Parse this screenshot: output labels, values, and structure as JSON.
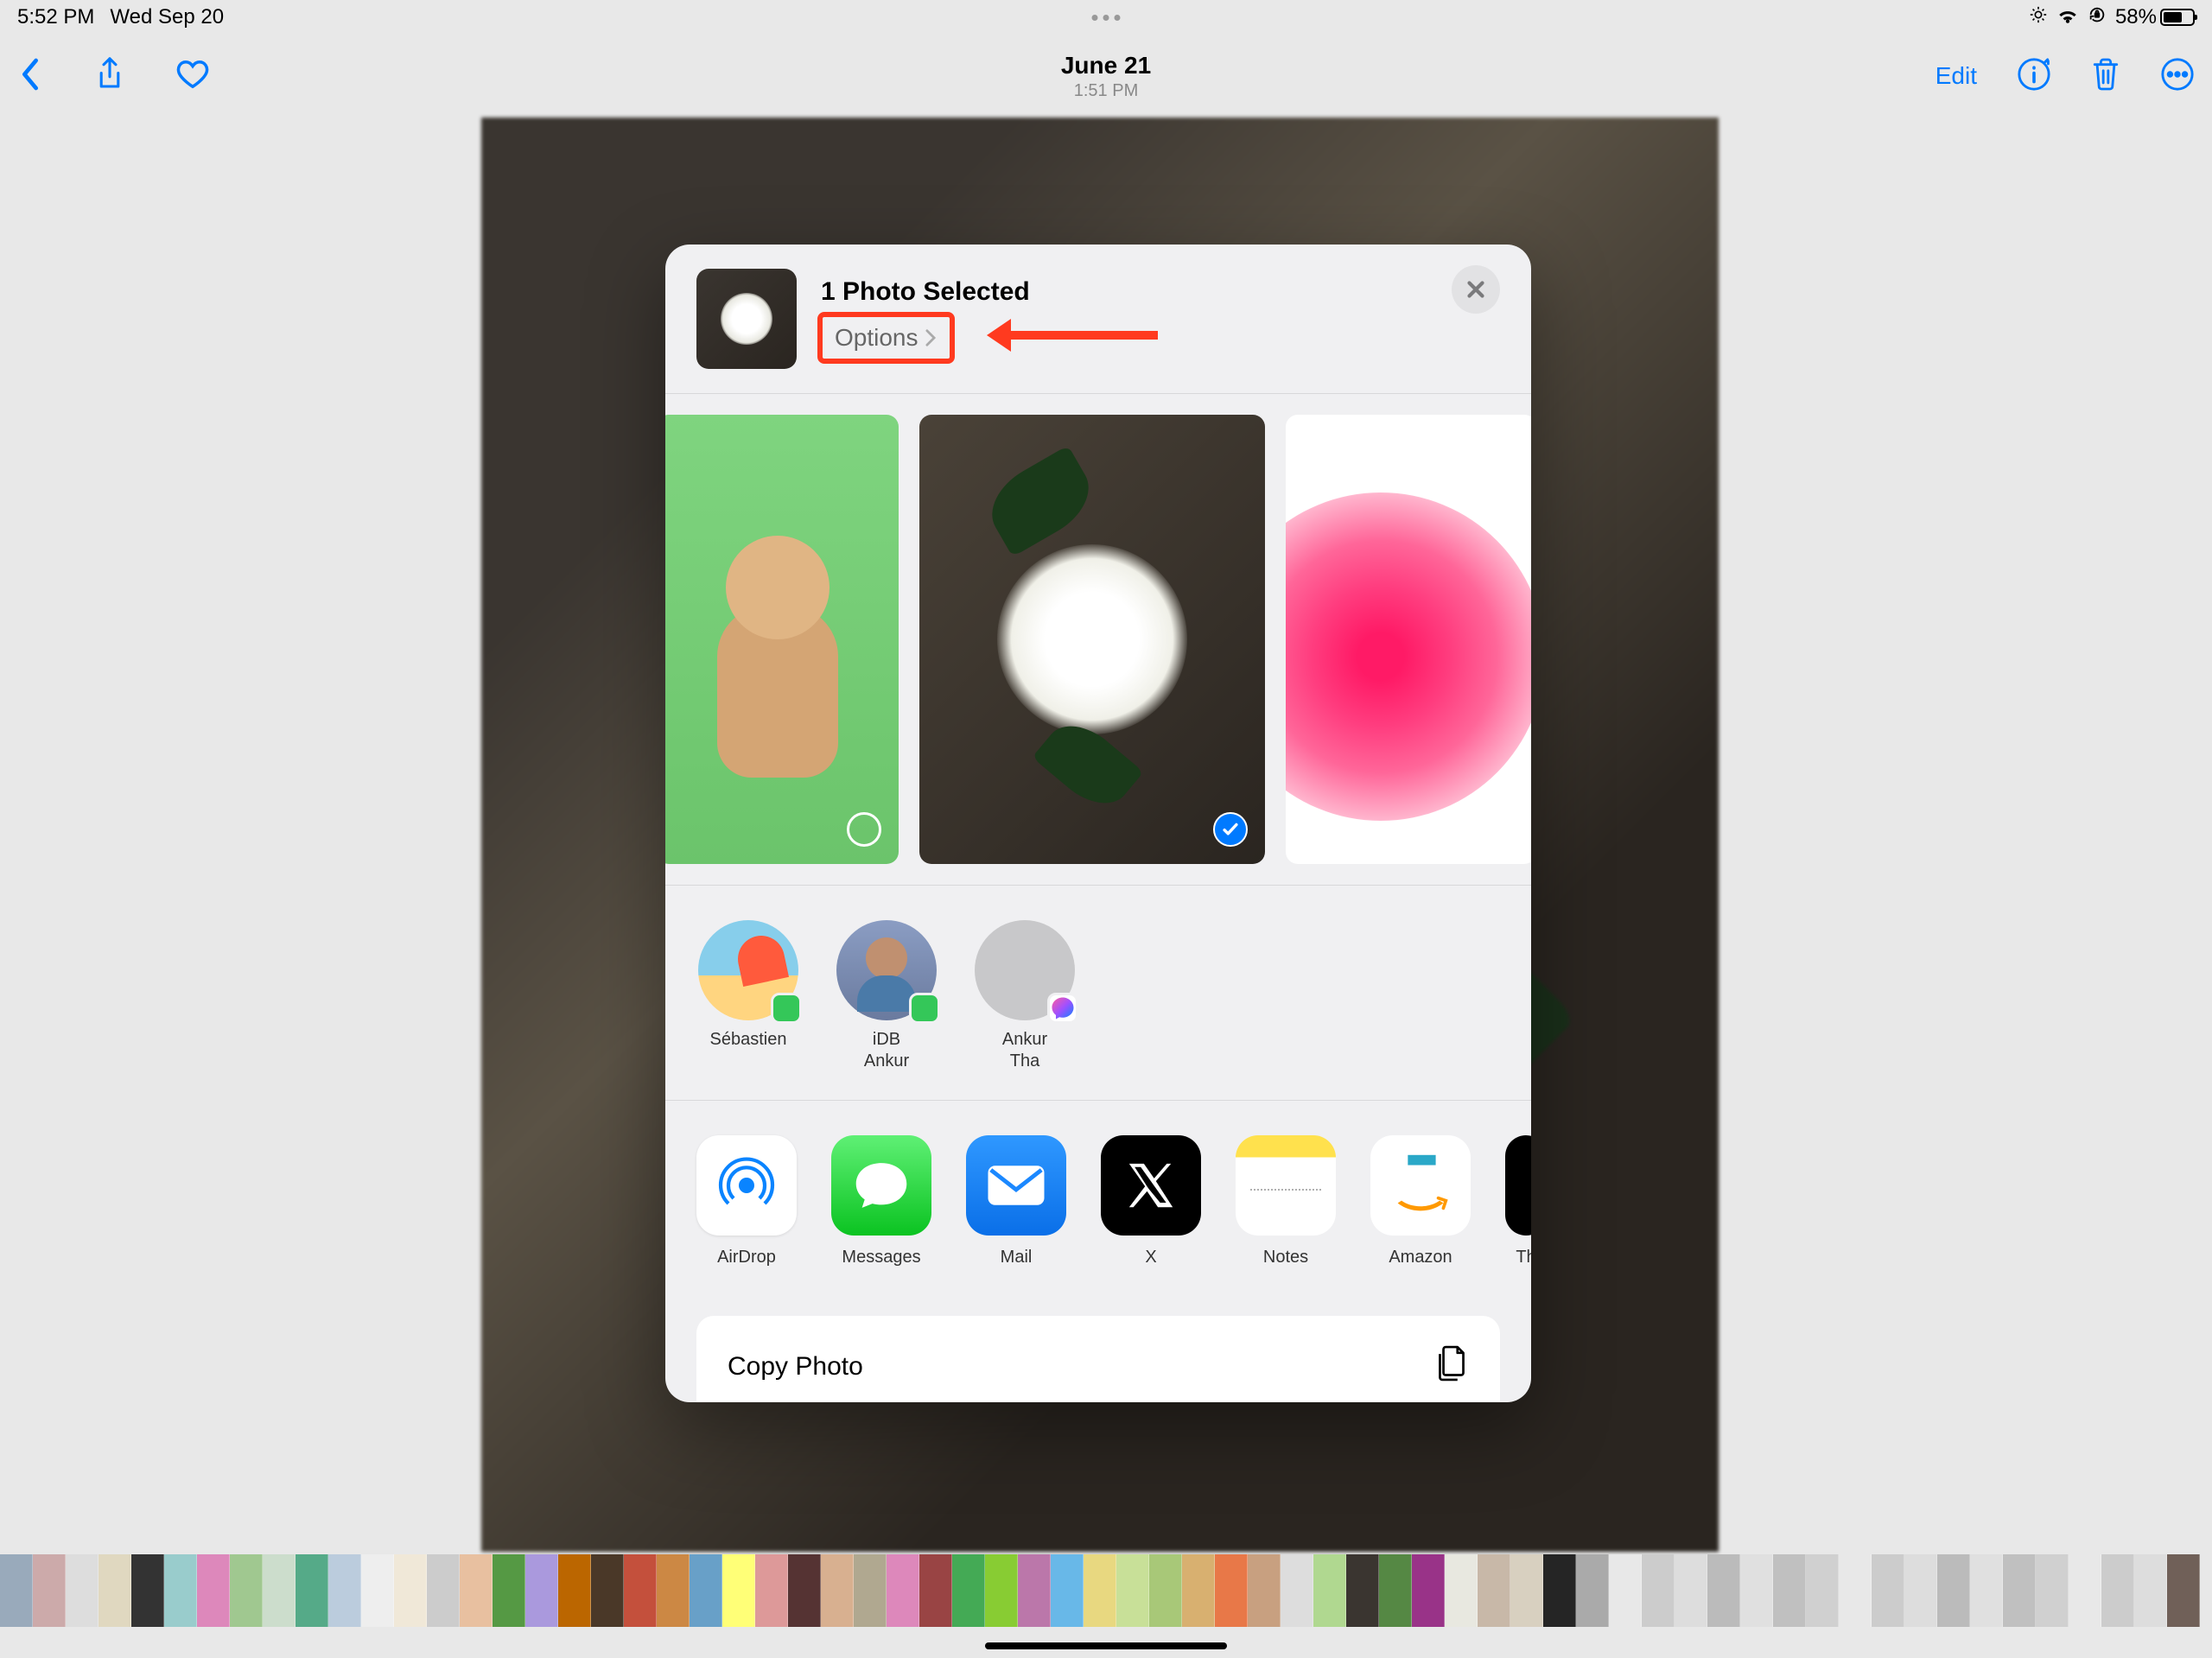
{
  "statusBar": {
    "time": "5:52 PM",
    "date": "Wed Sep 20",
    "battery": "58%"
  },
  "navBar": {
    "title": "June 21",
    "subtitle": "1:51 PM",
    "edit": "Edit"
  },
  "shareSheet": {
    "title": "1 Photo Selected",
    "options": "Options",
    "copyPhoto": "Copy Photo"
  },
  "contacts": [
    {
      "name": "Sébastien",
      "badge": "msg"
    },
    {
      "name": "iDB\nAnkur",
      "badge": "msg"
    },
    {
      "name": "Ankur\nTha",
      "badge": "fb"
    }
  ],
  "apps": [
    {
      "label": "AirDrop",
      "cls": "airdrop"
    },
    {
      "label": "Messages",
      "cls": "messages"
    },
    {
      "label": "Mail",
      "cls": "mail"
    },
    {
      "label": "X",
      "cls": "x"
    },
    {
      "label": "Notes",
      "cls": "notes"
    },
    {
      "label": "Amazon",
      "cls": "amazon"
    },
    {
      "label": "Th",
      "cls": "more"
    }
  ],
  "filmstripColors": [
    "#9ab",
    "#caa",
    "#ddd",
    "#e0d8c0",
    "#333",
    "#9cc",
    "#d8b",
    "#a0c890",
    "#cdc",
    "#5a8",
    "#bcd",
    "#eee",
    "#f0e8d8",
    "#ccc",
    "#e8c0a0",
    "#594",
    "#a9d",
    "#b60",
    "#4a3828",
    "#c4503c",
    "#c84",
    "#68a0c8",
    "#ff7",
    "#d99",
    "#533",
    "#d8b090",
    "#b0a890",
    "#d8b",
    "#944",
    "#4a5",
    "#8c3",
    "#b7a",
    "#68b8e8",
    "#e8d880",
    "#c8e098",
    "#a8c878",
    "#d8b070",
    "#e87848",
    "#c8a080",
    "#ddd",
    "#b0d890",
    "#3a3530",
    "#584",
    "#938",
    "#e8e8e0",
    "#c8b8a8",
    "#d8d0c0",
    "#252525",
    "#aaa",
    "#e8e8e8",
    "#ccc",
    "#ddd",
    "#bbb",
    "#e0e0e0",
    "#c0c0c0",
    "#d0d0d0",
    "#e8e8e8",
    "#ccc",
    "#ddd",
    "#bbb",
    "#e0e0e0",
    "#c0c0c0",
    "#d0d0d0",
    "#e8e8e8",
    "#ccc",
    "#ddd",
    "#706058"
  ]
}
